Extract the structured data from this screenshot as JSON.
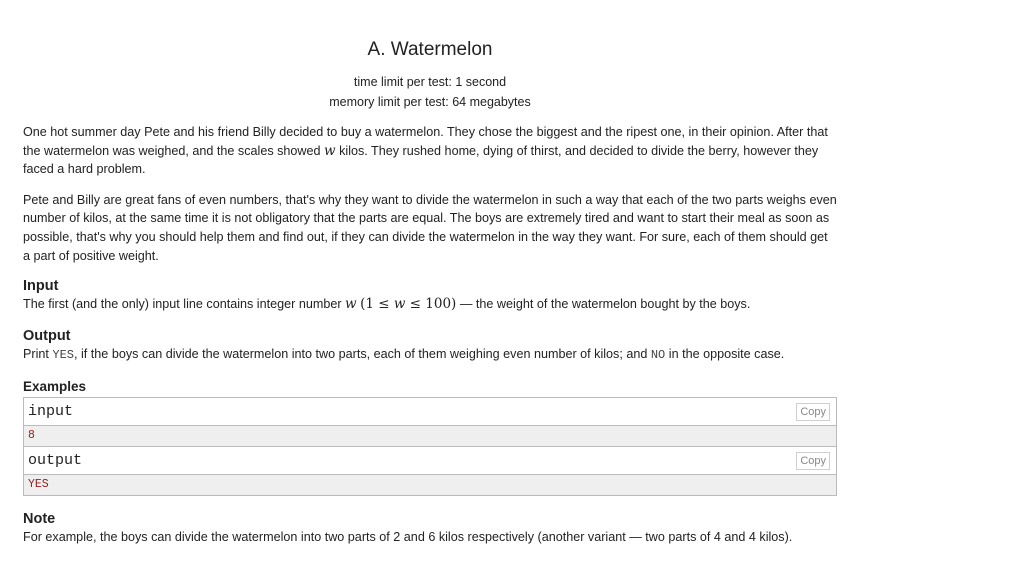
{
  "problem": {
    "title": "A. Watermelon",
    "time_limit": "time limit per test: 1 second",
    "memory_limit": "memory limit per test: 64 megabytes"
  },
  "statement": {
    "p1_a": "One hot summer day Pete and his friend Billy decided to buy a watermelon. They chose the biggest and the ripest one, in their opinion. After that the watermelon was weighed, and the scales showed ",
    "p1_var": "w",
    "p1_b": " kilos. They rushed home, dying of thirst, and decided to divide the berry, however they faced a hard problem.",
    "p2": "Pete and Billy are great fans of even numbers, that's why they want to divide the watermelon in such a way that each of the two parts weighs even number of kilos, at the same time it is not obligatory that the parts are equal. The boys are extremely tired and want to start their meal as soon as possible, that's why you should help them and find out, if they can divide the watermelon in the way they want. For sure, each of them should get a part of positive weight."
  },
  "input": {
    "title": "Input",
    "text_a": "The first (and the only) input line contains integer number ",
    "var": "w",
    "open": "(1 ≤ ",
    "var2": "w",
    "close": " ≤ 100)",
    "text_b": " — the weight of the watermelon bought by the boys."
  },
  "output": {
    "title": "Output",
    "text_a": "Print ",
    "yes": "YES",
    "text_b": ", if the boys can divide the watermelon into two parts, each of them weighing even number of kilos; and ",
    "no": "NO",
    "text_c": " in the opposite case."
  },
  "examples": {
    "title": "Examples",
    "input_label": "input",
    "input_value": "8",
    "output_label": "output",
    "output_value": "YES",
    "copy_label": "Copy"
  },
  "note": {
    "title": "Note",
    "text": "For example, the boys can divide the watermelon into two parts of 2 and 6 kilos respectively (another variant — two parts of 4 and 4 kilos)."
  }
}
